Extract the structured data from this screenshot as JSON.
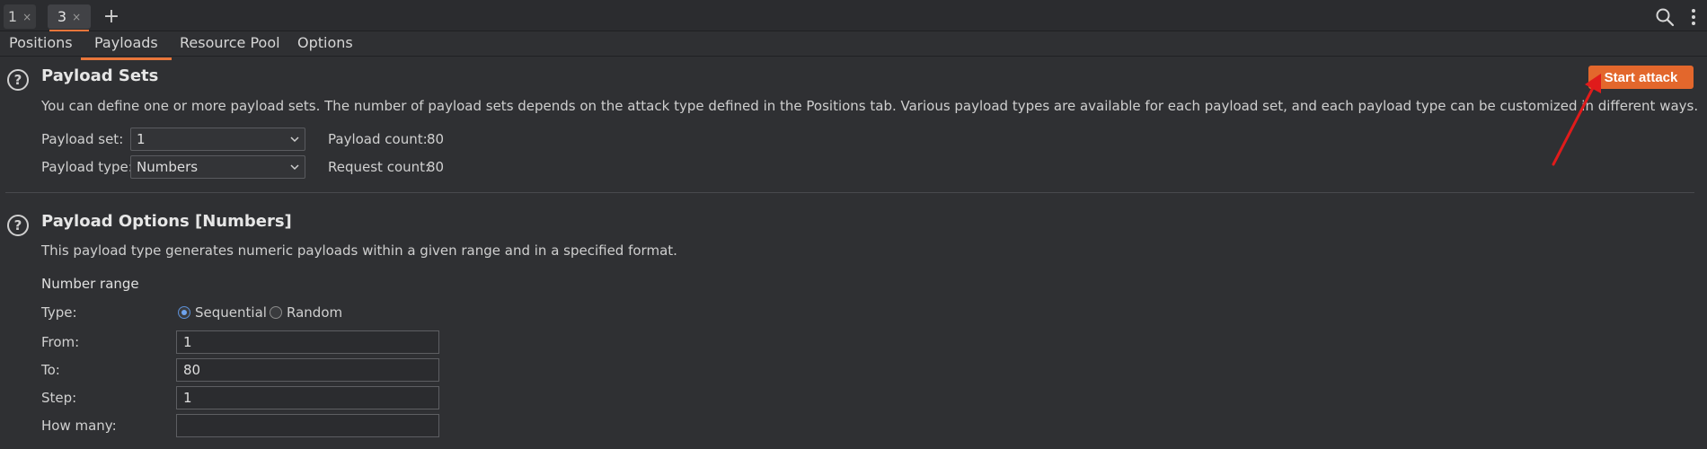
{
  "top_tabs": [
    {
      "label": "1",
      "close": "×"
    },
    {
      "label": "3",
      "close": "×"
    }
  ],
  "add_tab_label": "+",
  "sub_tabs": [
    "Positions",
    "Payloads",
    "Resource Pool",
    "Options"
  ],
  "active_sub_tab": "Payloads",
  "payload_sets": {
    "title": "Payload Sets",
    "description": "You can define one or more payload sets. The number of payload sets depends on the attack type defined in the Positions tab. Various payload types are available for each payload set, and each payload type can be customized in different ways.",
    "set_label": "Payload set:",
    "set_value": "1",
    "type_label": "Payload type:",
    "type_value": "Numbers",
    "payload_count_label": "Payload count:",
    "payload_count": "80",
    "request_count_label": "Request count:",
    "request_count": "80",
    "start_attack_label": "Start attack"
  },
  "payload_options": {
    "title": "Payload Options [Numbers]",
    "description": "This payload type generates numeric payloads within a given range and in a specified format.",
    "number_range_label": "Number range",
    "type_label": "Type:",
    "sequential_label": "Sequential",
    "random_label": "Random",
    "from_label": "From:",
    "from_value": "1",
    "to_label": "To:",
    "to_value": "80",
    "step_label": "Step:",
    "step_value": "1",
    "how_many_label": "How many:",
    "how_many_value": ""
  },
  "help_glyph": "?",
  "colors": {
    "accent": "#e8763b",
    "button": "#e3672c",
    "annotation_arrow": "#e01b1b",
    "background": "#2f3033"
  }
}
